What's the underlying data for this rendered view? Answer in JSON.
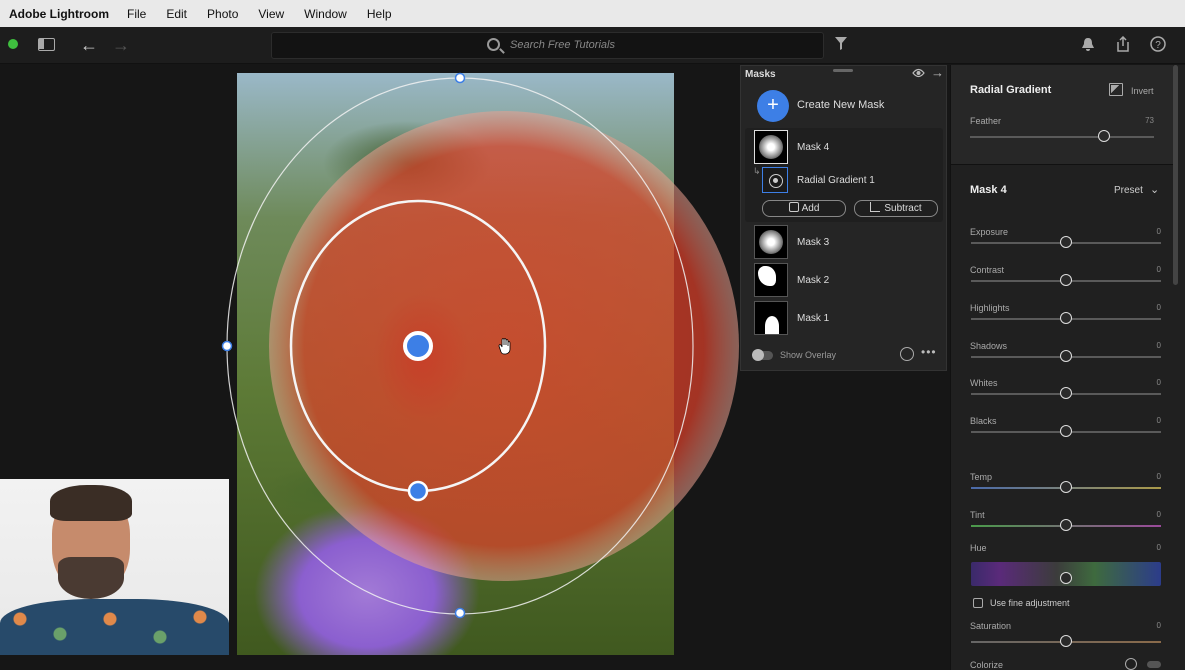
{
  "menubar": {
    "app_name": "Adobe Lightroom",
    "items": [
      "File",
      "Edit",
      "Photo",
      "View",
      "Window",
      "Help"
    ]
  },
  "toolbar": {
    "search_placeholder": "Search Free Tutorials",
    "icons": [
      "panel-icon",
      "back-arrow-icon",
      "forward-arrow-icon",
      "filter-icon",
      "bell-icon",
      "share-icon",
      "help-icon"
    ]
  },
  "masks_panel": {
    "title": "Masks",
    "create_label": "Create New Mask",
    "active_mask": {
      "name": "Mask 4",
      "component": "Radial Gradient 1",
      "add_label": "Add",
      "subtract_label": "Subtract"
    },
    "other_masks": [
      "Mask 3",
      "Mask 2",
      "Mask 1"
    ],
    "show_overlay_label": "Show Overlay"
  },
  "right_panel": {
    "tool_title": "Radial Gradient",
    "invert_label": "Invert",
    "feather": {
      "label": "Feather",
      "value": "73",
      "fraction": 0.73
    },
    "mask_title": "Mask 4",
    "preset_label": "Preset",
    "sliders": [
      {
        "label": "Exposure",
        "value": "0",
        "fraction": 0.5
      },
      {
        "label": "Contrast",
        "value": "0",
        "fraction": 0.5
      },
      {
        "label": "Highlights",
        "value": "0",
        "fraction": 0.5
      },
      {
        "label": "Shadows",
        "value": "0",
        "fraction": 0.5
      },
      {
        "label": "Whites",
        "value": "0",
        "fraction": 0.5
      },
      {
        "label": "Blacks",
        "value": "0",
        "fraction": 0.5
      },
      {
        "label": "Temp",
        "value": "0",
        "fraction": 0.5
      },
      {
        "label": "Tint",
        "value": "0",
        "fraction": 0.5
      }
    ],
    "hue": {
      "label": "Hue",
      "value": "0",
      "fraction": 0.5
    },
    "fine_adjust_label": "Use fine adjustment",
    "saturation": {
      "label": "Saturation",
      "value": "0",
      "fraction": 0.5
    },
    "colorize_label": "Colorize"
  },
  "colors": {
    "accent": "#3d7fe6",
    "mask_overlay": "#e0402a"
  }
}
